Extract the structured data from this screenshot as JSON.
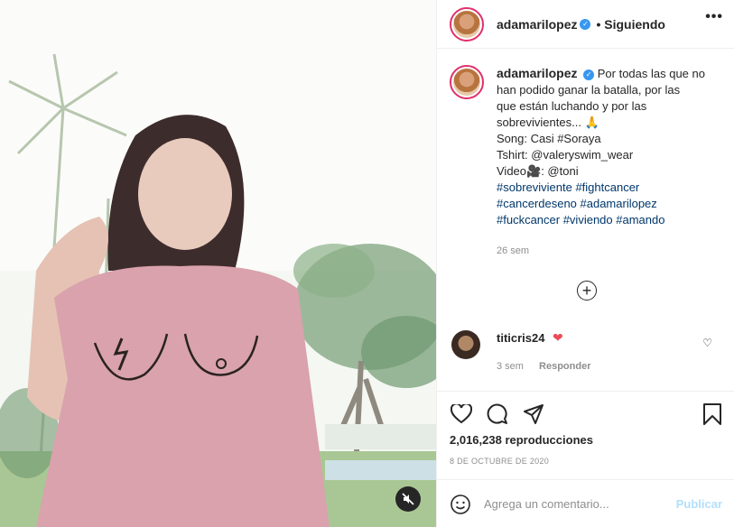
{
  "post": {
    "username": "adamarilopez",
    "verified_icon": "verified-badge-icon",
    "follow_status": "• Siguiendo",
    "more_icon": "more-options-icon",
    "more_glyph": "•••"
  },
  "caption": {
    "username": "adamarilopez",
    "lines": [
      "Por todas las que no",
      "han podido ganar la batalla, por las",
      "que están luchando y por las",
      "sobrevivientes... 🙏",
      "Song: Casi #Soraya",
      "Tshirt: @valeryswim_wear",
      "Video🎥: @toni",
      "#sobreviviente #fightcancer",
      "#cancerdeseno #adamarilopez",
      "#fuckcancer #viviendo #amando"
    ],
    "time_ago": "26 sem"
  },
  "load_more_glyph": "+",
  "comment": {
    "username": "titicris24",
    "heart": "❤",
    "time": "3 sem",
    "reply": "Responder",
    "like_glyph": "♡"
  },
  "stats": {
    "views": "2,016,238 reproducciones",
    "date": "8 DE OCTUBRE DE 2020"
  },
  "add_comment": {
    "placeholder": "Agrega un comentario...",
    "publish": "Publicar"
  },
  "colors": {
    "accent": "#3897f0",
    "heart": "#ed4956",
    "publish_disabled": "#b2dffc",
    "shirt": "#d9a2ad"
  }
}
